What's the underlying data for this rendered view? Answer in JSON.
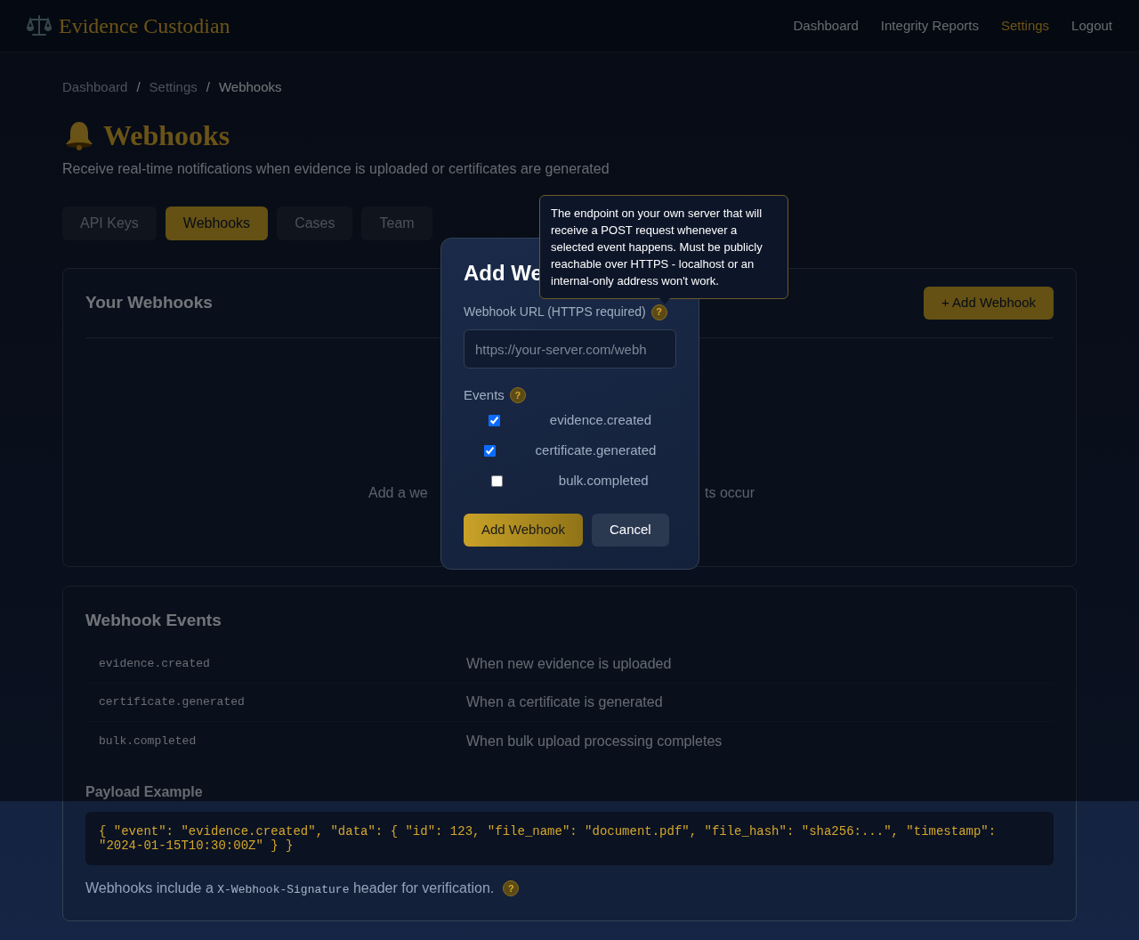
{
  "header": {
    "brand": "Evidence Custodian",
    "nav": [
      {
        "label": "Dashboard",
        "selected": false
      },
      {
        "label": "Integrity Reports",
        "selected": false
      },
      {
        "label": "Settings",
        "selected": true
      },
      {
        "label": "Logout",
        "selected": false
      }
    ]
  },
  "breadcrumb": [
    "Dashboard",
    "Settings",
    "Webhooks"
  ],
  "breadcrumb_separator": "/",
  "page": {
    "title": "Webhooks",
    "subtitle": "Receive real-time notifications when evidence is uploaded or certificates are generated"
  },
  "tabs": [
    {
      "label": "API Keys",
      "selected": false
    },
    {
      "label": "Webhooks",
      "selected": true
    },
    {
      "label": "Cases",
      "selected": false
    },
    {
      "label": "Team",
      "selected": false
    }
  ],
  "webhooks_card": {
    "title": "Your Webhooks",
    "add_button": "+ Add Webhook",
    "empty_text_left": "Add a we",
    "empty_text_right": "ts occur"
  },
  "events_card": {
    "title": "Webhook Events",
    "events": [
      {
        "name": "evidence.created",
        "description": "When new evidence is uploaded"
      },
      {
        "name": "certificate.generated",
        "description": "When a certificate is generated"
      },
      {
        "name": "bulk.completed",
        "description": "When bulk upload processing completes"
      }
    ],
    "payload_title": "Payload Example",
    "payload": "{ \"event\": \"evidence.created\", \"data\": { \"id\": 123, \"file_name\": \"document.pdf\", \"file_hash\": \"sha256:...\", \"timestamp\": \"2024-01-15T10:30:00Z\" } }",
    "note_before": "Webhooks include a",
    "note_code": "X-Webhook-Signature",
    "note_after": "header for verification.",
    "note_help": "?"
  },
  "modal": {
    "title": "Add We",
    "url_label": "Webhook URL",
    "url_label_hint": "(HTTPS required)",
    "url_help": "?",
    "url_placeholder": "https://your-server.com/webh",
    "events_label": "Events",
    "events_help": "?",
    "events": [
      {
        "label": "evidence.created",
        "checked": true
      },
      {
        "label": "certificate.generated",
        "checked": true
      },
      {
        "label": "bulk.completed",
        "checked": false
      }
    ],
    "submit": "Add Webhook",
    "cancel": "Cancel"
  },
  "tooltip": "The endpoint on your own server that will receive a POST request whenever a selected event happens. Must be publicly reachable over HTTPS - localhost or an internal-only address won't work."
}
